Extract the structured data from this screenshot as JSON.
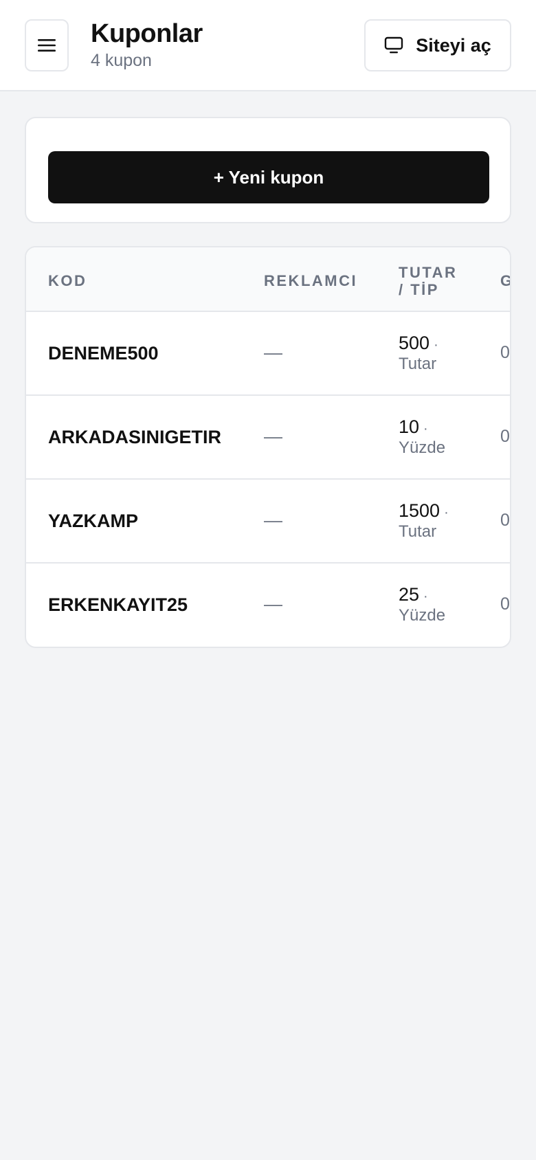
{
  "header": {
    "title": "Kuponlar",
    "subtitle": "4 kupon",
    "open_site_label": "Siteyi aç",
    "menu_icon": "hamburger-icon",
    "monitor_icon": "monitor-icon"
  },
  "new_coupon": {
    "label": "+ Yeni kupon"
  },
  "table": {
    "columns": {
      "code": "KOD",
      "advertiser": "REKLAMCI",
      "amount_type_line1": "TUTAR",
      "amount_type_line2": "/ TİP",
      "next": "G"
    },
    "rows": [
      {
        "code": "DENEME500",
        "advertiser": "—",
        "amount": "500",
        "sep": "·",
        "type": "Tutar",
        "next": "0"
      },
      {
        "code": "ARKADASINIGETIR",
        "advertiser": "—",
        "amount": "10",
        "sep": "·",
        "type": "Yüzde",
        "next": "0"
      },
      {
        "code": "YAZKAMP",
        "advertiser": "—",
        "amount": "1500",
        "sep": "·",
        "type": "Tutar",
        "next": "0"
      },
      {
        "code": "ERKENKAYIT25",
        "advertiser": "—",
        "amount": "25",
        "sep": "·",
        "type": "Yüzde",
        "next": "0"
      }
    ]
  },
  "colors": {
    "background": "#f3f4f6",
    "primary_button": "#111111",
    "muted_text": "#6b7280",
    "border": "#e5e7eb"
  }
}
